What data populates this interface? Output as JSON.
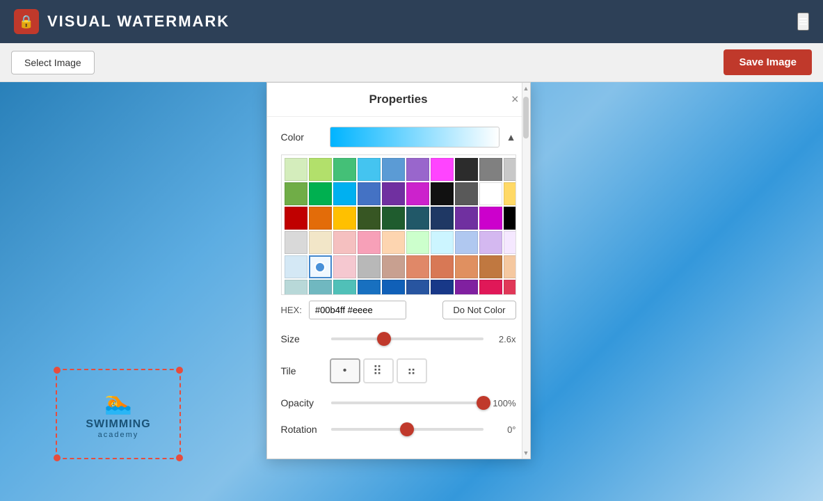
{
  "header": {
    "title": "VISUAL WATERMARK",
    "lock_icon": "🔒",
    "menu_icon": "≡"
  },
  "toolbar": {
    "select_image_label": "Select Image",
    "save_image_label": "Save Image"
  },
  "properties_panel": {
    "title": "Properties",
    "close_label": "×",
    "color_label": "Color",
    "hex_label": "HEX:",
    "hex_value": "#00b4ff #eeee",
    "do_not_color_label": "Do Not Color",
    "size_label": "Size",
    "size_value": "2.6x",
    "size_percent": 35,
    "tile_label": "Tile",
    "opacity_label": "Opacity",
    "opacity_value": "100%",
    "opacity_percent": 100,
    "rotation_label": "Rotation",
    "rotation_value": "0°",
    "rotation_percent": 50
  },
  "color_grid": {
    "colors_row1": [
      "#a8d08d",
      "#92d050",
      "#00b050",
      "#00b0f0",
      "#0070c0",
      "#7030a0",
      "#ff00ff",
      "#000000",
      "#7f7f7f",
      "#d9d9d9",
      "#ffff00"
    ],
    "colors_row2": [
      "#70ad47",
      "#00b050",
      "#00b0f0",
      "#4472c4",
      "#9e48b2",
      "#ff00ff",
      "#000000",
      "#595959",
      "#ffffff",
      "#ffd966"
    ],
    "colors_row3": [
      "#c00000",
      "#e36c09",
      "#ffc000",
      "#375623",
      "#1f5c2e",
      "#215868",
      "#1f3864",
      "#7030a0",
      "#ff00ff",
      "#000000"
    ],
    "colors_row4": [
      "#d9d9d9",
      "#ffd966",
      "#ff9999",
      "#ff6699",
      "#ffcc99",
      "#ccffcc",
      "#ccffff",
      "#99ccff",
      "#cc99ff"
    ],
    "colors_row5": [
      "#87ceeb",
      "#4fc3f7",
      "#f48fb1",
      "#b0bec5",
      "#ffab91",
      "#ce93d8",
      "#80cbc4",
      "#e6ee9c",
      "#ffcc80"
    ],
    "colors_row6": [
      "#d4c5a9",
      "#c8b89a",
      "#d4a574",
      "#8bc34a",
      "#26a69a",
      "#1976d2",
      "#1565c0",
      "#9c27b0",
      "#e91e63"
    ],
    "colors_row7": [
      "#8d6e63",
      "#ff7043",
      "#ffb74d",
      "#aed581",
      "#4dd0e1",
      "#4fc3f7",
      "#64b5f6",
      "#9575cd",
      "#f06292"
    ]
  },
  "tile_options": [
    {
      "icon": "·",
      "type": "single"
    },
    {
      "icon": "⁞⁞",
      "type": "grid"
    },
    {
      "icon": "⁚⁚",
      "type": "scattered"
    }
  ]
}
